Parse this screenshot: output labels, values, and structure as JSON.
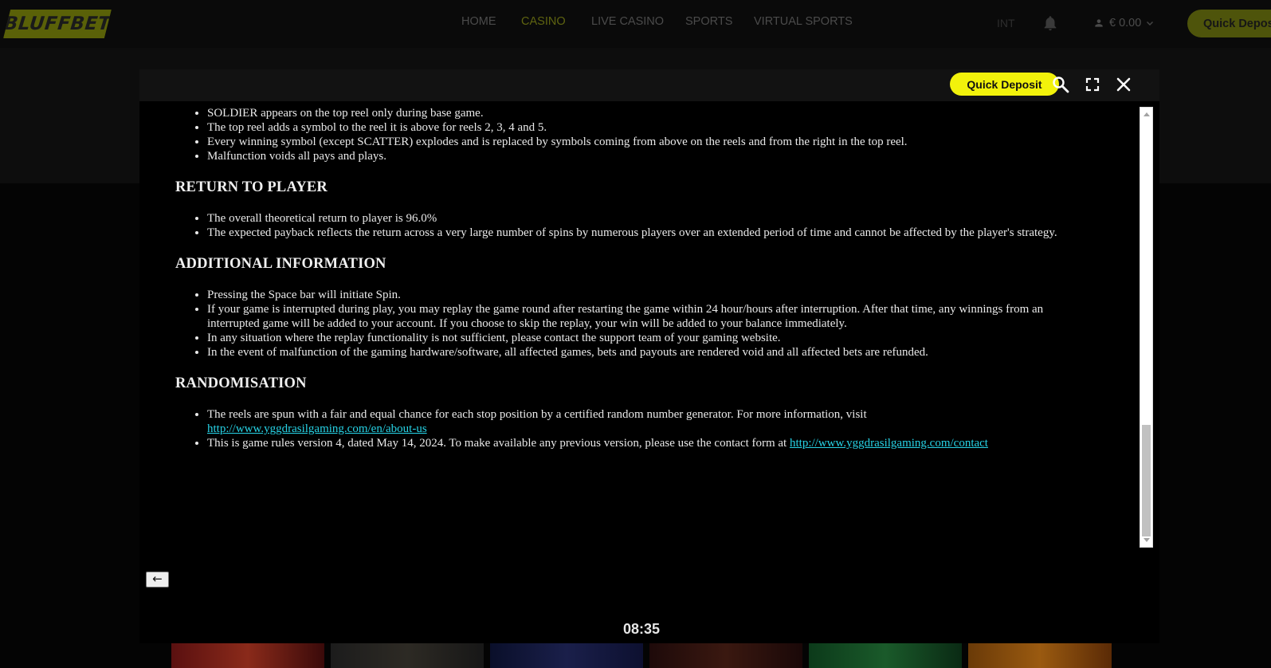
{
  "brand": {
    "name": "BLUFFBET"
  },
  "nav": {
    "items": [
      {
        "label": "HOME",
        "active": false
      },
      {
        "label": "CASINO",
        "active": true
      },
      {
        "label": "LIVE CASINO",
        "active": false
      },
      {
        "label": "SPORTS",
        "active": false
      },
      {
        "label": "VIRTUAL SPORTS",
        "active": false
      }
    ]
  },
  "account": {
    "language": "INT",
    "balance": "€ 0.00",
    "quick_deposit_label": "Quick Deposit"
  },
  "modal": {
    "quick_deposit_label": "Quick Deposit",
    "back_label": "←",
    "timer": "08:35"
  },
  "rules": {
    "intro_items": [
      "SOLDIER appears on the top reel only during base game.",
      "The top reel adds a symbol to the reel it is above for reels 2, 3, 4 and 5.",
      "Every winning symbol (except SCATTER) explodes and is replaced by symbols coming from above on the reels and from the right in the top reel.",
      "Malfunction voids all pays and plays."
    ],
    "return_heading": "RETURN TO PLAYER",
    "return_items": [
      "The overall theoretical return to player is 96.0%",
      "The expected payback reflects the return across a very large number of spins by numerous players over an extended period of time and cannot be affected by the player's strategy."
    ],
    "additional_heading": "ADDITIONAL INFORMATION",
    "additional_items": [
      "Pressing the Space bar will initiate Spin.",
      "If your game is interrupted during play, you may replay the game round after restarting the game within 24 hour/hours after interruption. After that time, any winnings from an interrupted game will be added to your account. If you choose to skip the replay, your win will be added to your balance immediately.",
      "In any situation where the replay functionality is not sufficient, please contact the support team of your gaming website.",
      "In the event of malfunction of the gaming hardware/software, all affected games, bets and payouts are rendered void and all affected bets are refunded."
    ],
    "randomisation_heading": "RANDOMISATION",
    "randomisation_item1_text": "The reels are spun with a fair and equal chance for each stop position by a certified random number generator. For more information, visit",
    "randomisation_item1_link": "http://www.yggdrasilgaming.com/en/about-us",
    "randomisation_item2_text": "This is game rules version 4, dated May 14, 2024. To make available any previous version, please use the contact form at",
    "randomisation_item2_link": "http://www.yggdrasilgaming.com/contact"
  },
  "colors": {
    "accent": "#f2f20b",
    "link": "#27d3e6",
    "background": "#000000"
  },
  "icons": {
    "notifications": "bell-icon",
    "user": "user-icon",
    "search": "search-icon",
    "fullscreen": "fullscreen-icon",
    "close": "close-icon"
  }
}
